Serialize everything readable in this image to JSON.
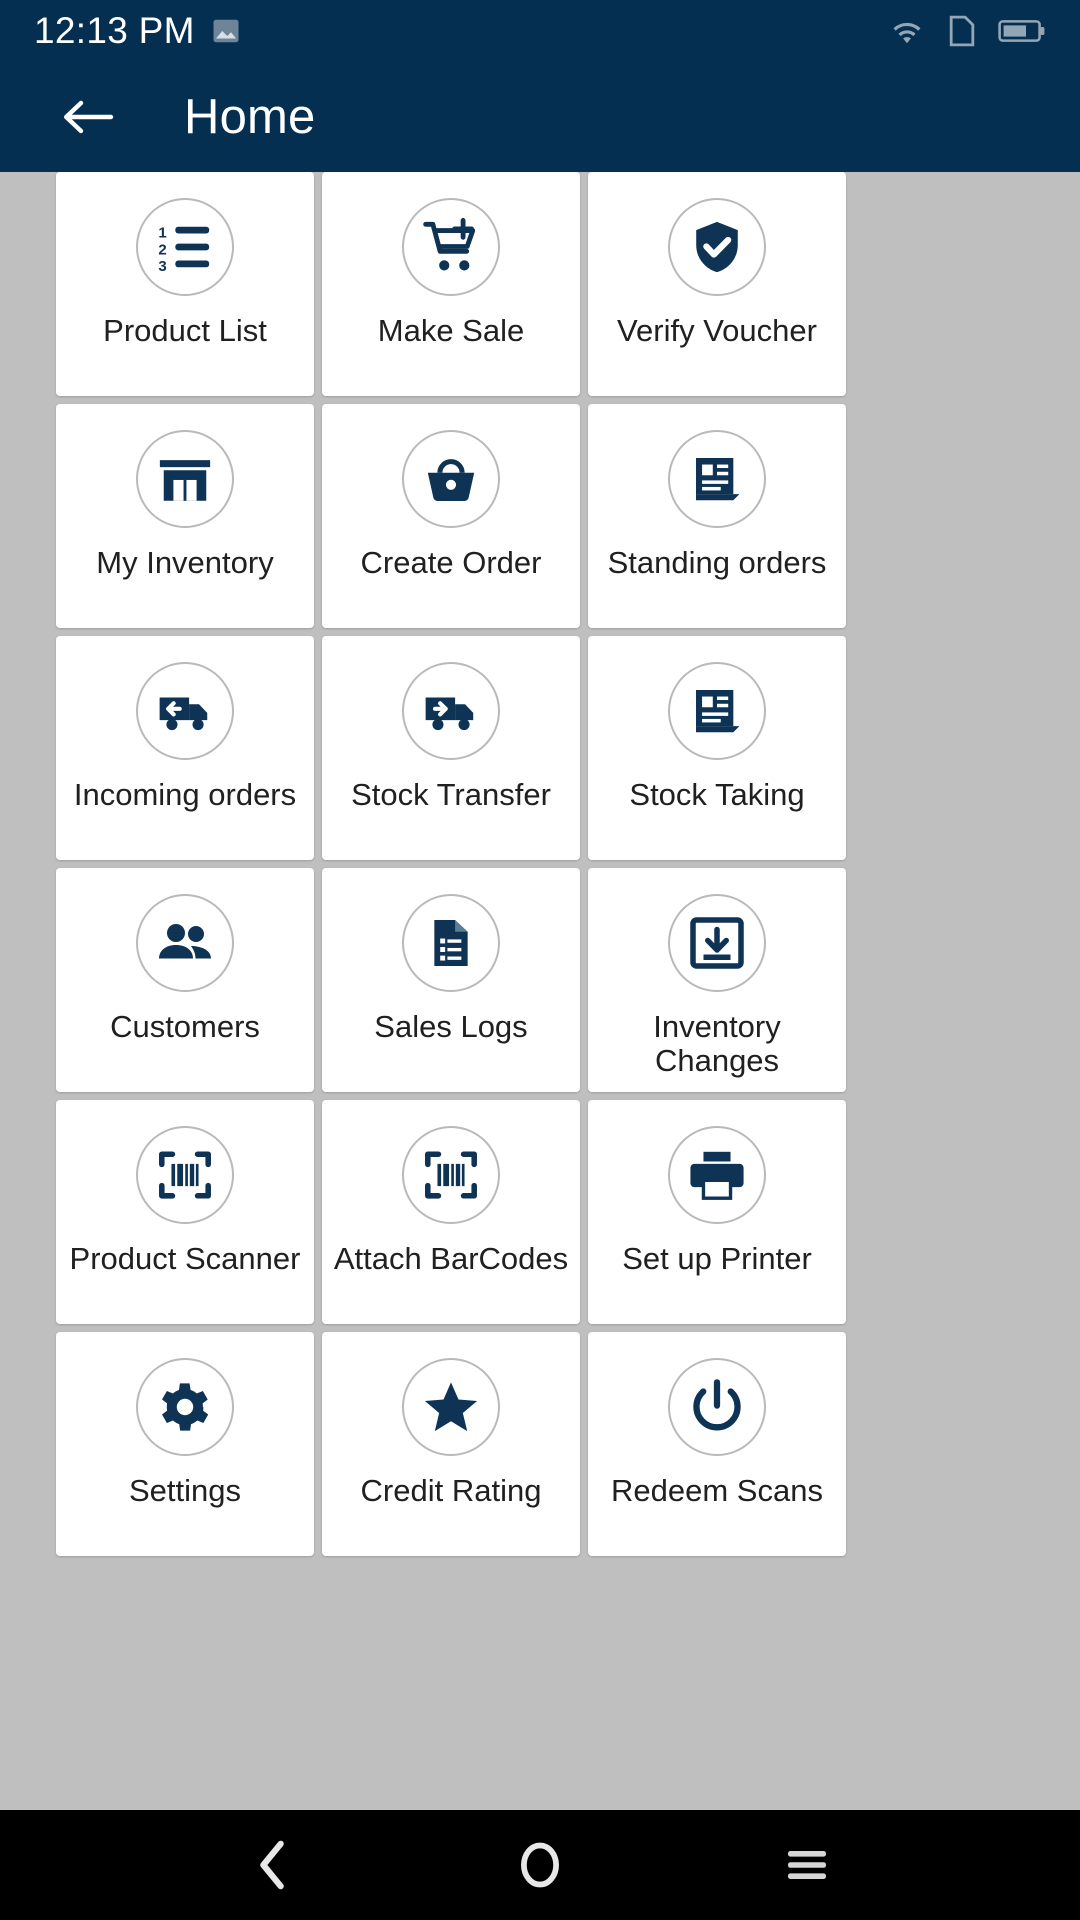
{
  "status_bar": {
    "time": "12:13 PM",
    "icons": [
      "image-icon",
      "wifi-icon",
      "sim-card-icon",
      "battery-icon"
    ],
    "background_color": "#042F51",
    "text_color": "#FFFFFF"
  },
  "app_bar": {
    "back_label": "",
    "title": "Home",
    "background_color": "#042F51"
  },
  "theme": {
    "accent": "#0E3354",
    "page_background": "#BFBFBF",
    "tile_background": "#FFFFFF",
    "circle_border": "#B9B9B9",
    "label_color": "#202020",
    "nav_background": "#000000"
  },
  "grid": {
    "columns": 3,
    "tiles": [
      {
        "label": "Product List",
        "icon": "numbered-list-icon"
      },
      {
        "label": "Make Sale",
        "icon": "cart-plus-icon"
      },
      {
        "label": "Verify Voucher",
        "icon": "shield-check-icon"
      },
      {
        "label": "My Inventory",
        "icon": "store-icon"
      },
      {
        "label": "Create Order",
        "icon": "basket-icon"
      },
      {
        "label": "Standing orders",
        "icon": "document-list-icon"
      },
      {
        "label": "Incoming orders",
        "icon": "truck-incoming-icon"
      },
      {
        "label": "Stock Transfer",
        "icon": "truck-outgoing-icon"
      },
      {
        "label": "Stock Taking",
        "icon": "document-list-icon"
      },
      {
        "label": "Customers",
        "icon": "people-icon"
      },
      {
        "label": "Sales Logs",
        "icon": "file-list-icon"
      },
      {
        "label": "Inventory Changes",
        "icon": "import-download-icon"
      },
      {
        "label": "Product Scanner",
        "icon": "barcode-scan-icon"
      },
      {
        "label": "Attach BarCodes",
        "icon": "barcode-scan-icon"
      },
      {
        "label": "Set up Printer",
        "icon": "printer-icon"
      },
      {
        "label": "Settings",
        "icon": "gear-icon"
      },
      {
        "label": "Credit Rating",
        "icon": "star-icon"
      },
      {
        "label": "Redeem Scans",
        "icon": "power-icon"
      }
    ]
  },
  "nav_bar": {
    "buttons": [
      {
        "name": "back",
        "icon": "chevron-left-icon"
      },
      {
        "name": "home",
        "icon": "circle-icon"
      },
      {
        "name": "recents",
        "icon": "hamburger-icon"
      }
    ]
  }
}
